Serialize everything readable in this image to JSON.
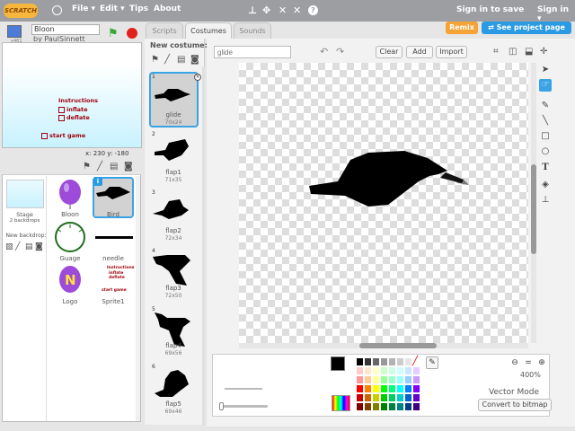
{
  "topbar": {
    "logo": "SCRATCH",
    "menus": [
      "File",
      "Edit",
      "Tips",
      "About"
    ],
    "sign_in_to_save": "Sign in to save",
    "sign_in": "Sign in"
  },
  "project": {
    "title": "Bloon",
    "byline": "by PaulSinnett",
    "version": "v461"
  },
  "stage_view": {
    "instructions": "Instructions",
    "inflate": "inflate",
    "deflate": "deflate",
    "start_game": "start game",
    "coords": "x: 230  y: -180"
  },
  "sprites_panel": {
    "stage_label": "Stage",
    "stage_backdrops": "2 backdrops",
    "new_backdrop": "New backdrop:",
    "sprites": [
      {
        "name": "Bloon"
      },
      {
        "name": "Bird",
        "selected": true
      },
      {
        "name": "Guage"
      },
      {
        "name": "needle"
      },
      {
        "name": "Logo"
      },
      {
        "name": "Sprite1"
      }
    ],
    "sprite1_thumb": {
      "instructions": "Instructions",
      "inflate": "inflate",
      "deflate": "deflate",
      "start_game": "start game"
    }
  },
  "tabs": [
    "Scripts",
    "Costumes",
    "Sounds"
  ],
  "active_tab": "Costumes",
  "buttons": {
    "remix": "Remix",
    "see_project_page": "See project page"
  },
  "costumes": {
    "new_costume": "New costume:",
    "items": [
      {
        "num": "1",
        "name": "glide",
        "dim": "70x24"
      },
      {
        "num": "2",
        "name": "flap1",
        "dim": "71x35"
      },
      {
        "num": "3",
        "name": "flap2",
        "dim": "72x34"
      },
      {
        "num": "4",
        "name": "flap3",
        "dim": "72x50"
      },
      {
        "num": "5",
        "name": "flap4",
        "dim": "69x56"
      },
      {
        "num": "6",
        "name": "flap5",
        "dim": "69x46"
      }
    ]
  },
  "editor": {
    "costume_name_placeholder": "glide",
    "clear": "Clear",
    "add": "Add",
    "import": "Import",
    "zoom": "400%",
    "mode": "Vector Mode",
    "convert": "Convert to bitmap"
  },
  "colors": {
    "accent": "#2a9ae2",
    "remix": "#f6a335",
    "topbar": "#9c9ea2",
    "palette": [
      "#000000",
      "#333333",
      "#666666",
      "#999999",
      "#b3b3b3",
      "#cccccc",
      "#e6e6e6",
      "#ffffff",
      "#ffcccc",
      "#ffe6cc",
      "#ffffcc",
      "#ccffcc",
      "#ccffe6",
      "#ccffff",
      "#cce6ff",
      "#e6ccff",
      "#ff9999",
      "#ffcc99",
      "#ffff99",
      "#99ff99",
      "#99ffcc",
      "#99ffff",
      "#99ccff",
      "#cc99ff",
      "#ff0000",
      "#ff8000",
      "#ffff00",
      "#00ff00",
      "#00ff80",
      "#00ffff",
      "#0080ff",
      "#8000ff",
      "#cc0000",
      "#cc6600",
      "#cccc00",
      "#00cc00",
      "#00cc66",
      "#00cccc",
      "#0066cc",
      "#6600cc",
      "#800000",
      "#804000",
      "#808000",
      "#008000",
      "#008040",
      "#008080",
      "#004080",
      "#400080"
    ]
  }
}
